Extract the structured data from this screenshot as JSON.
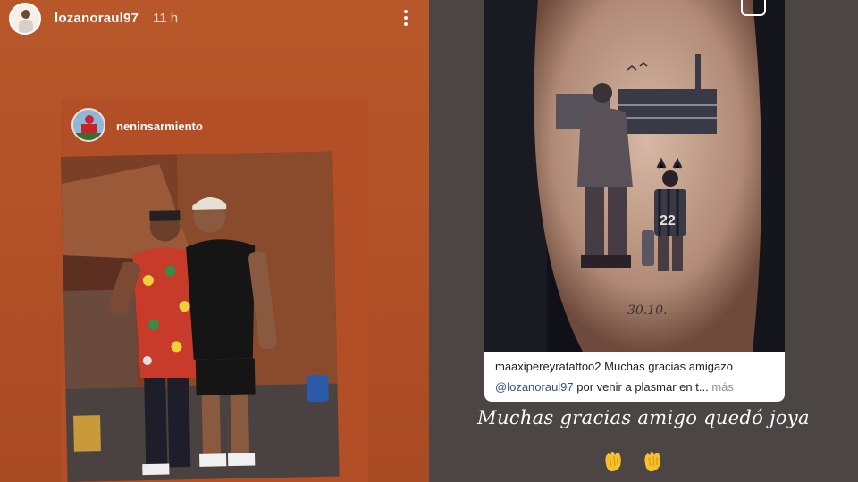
{
  "left_story": {
    "username": "lozanoraul97",
    "time": "11 h",
    "more_icon": "more-vertical-icon",
    "repost": {
      "username": "neninsarmiento"
    },
    "colors": {
      "background": "#b8582a"
    }
  },
  "right_story": {
    "comment": {
      "author": "maaxipereyratattoo2",
      "text_line1": "Muchas gracias amigazo",
      "mention": "@lozanoraul97",
      "text_line2": "por venir a plasmar en t...",
      "more_label": "más"
    },
    "caption": "Muchas gracias amigo quedó joya",
    "emojis": [
      "clapping-hands-icon",
      "clapping-hands-icon"
    ],
    "tattoo_jersey_number": "22",
    "tattoo_date": "30.10.",
    "colors": {
      "background": "#4b4644",
      "mention": "#385185"
    }
  }
}
